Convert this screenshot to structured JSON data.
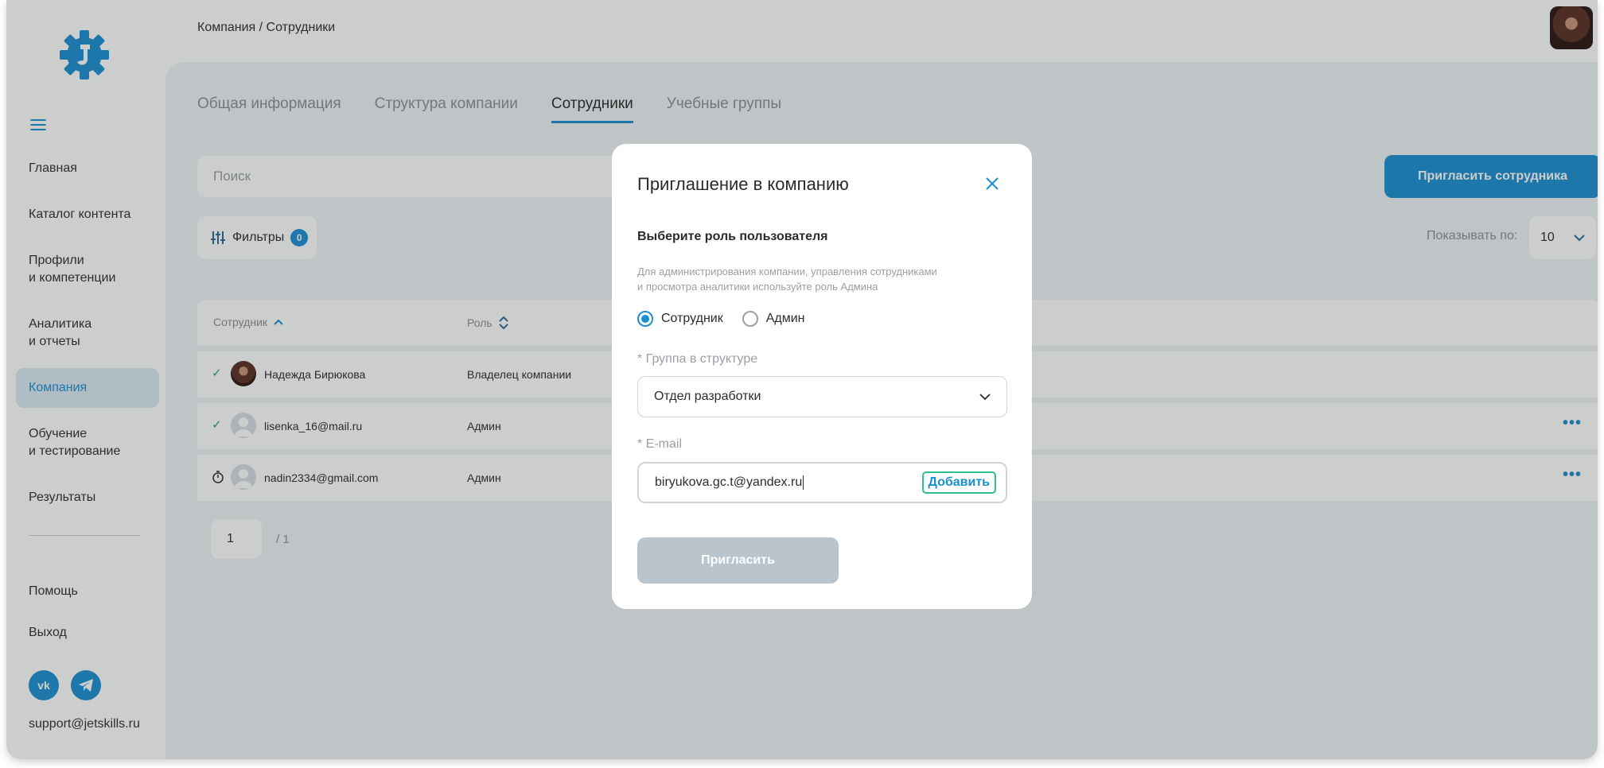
{
  "header": {
    "breadcrumb": "Компания / Сотрудники"
  },
  "sidebar": {
    "items": [
      {
        "label": "Главная"
      },
      {
        "label": "Каталог контента"
      },
      {
        "label": "Профили\nи компетенции"
      },
      {
        "label": "Аналитика\nи отчеты"
      },
      {
        "label": "Компания",
        "active": true
      },
      {
        "label": "Обучение\nи тестирование"
      },
      {
        "label": "Результаты"
      }
    ],
    "help": "Помощь",
    "logout": "Выход",
    "support_email": "support@jetskills.ru",
    "social": [
      "vk-icon",
      "telegram-icon"
    ]
  },
  "main": {
    "tabs": [
      {
        "label": "Общая информация"
      },
      {
        "label": "Структура компании"
      },
      {
        "label": "Сотрудники",
        "active": true
      },
      {
        "label": "Учебные группы"
      }
    ],
    "search_placeholder": "Поиск",
    "invite_button": "Пригласить сотрудника",
    "filters_label": "Фильтры",
    "filters_count": "0",
    "show_per_label": "Показывать по:",
    "show_per_value": "10",
    "table": {
      "col_employee": "Сотрудник",
      "col_role": "Роль",
      "rows": [
        {
          "status": "active",
          "name": "Надежда Бирюкова",
          "role": "Владелец компании"
        },
        {
          "status": "active",
          "name": "lisenka_16@mail.ru",
          "role": "Админ"
        },
        {
          "status": "pending",
          "name": "nadin2334@gmail.com",
          "role": "Админ"
        }
      ]
    },
    "pagination": {
      "page": "1",
      "total": "/ 1"
    }
  },
  "modal": {
    "title": "Приглашение в компанию",
    "role_label": "Выберите роль пользователя",
    "role_hint": "Для администрирования компании, управления сотрудниками\nи просмотра аналитики используйте роль Админа",
    "roles": [
      {
        "label": "Сотрудник",
        "checked": true
      },
      {
        "label": "Админ",
        "checked": false
      }
    ],
    "group_label": "* Группа в структуре",
    "group_value": "Отдел разработки",
    "email_label": "* E-mail",
    "email_value": "biryukova.gc.t@yandex.ru",
    "add_button": "Добавить",
    "submit_button": "Пригласить"
  },
  "colors": {
    "accent": "#1a8fd2",
    "success": "#2fa36b",
    "disabled": "#b9c4cc"
  }
}
